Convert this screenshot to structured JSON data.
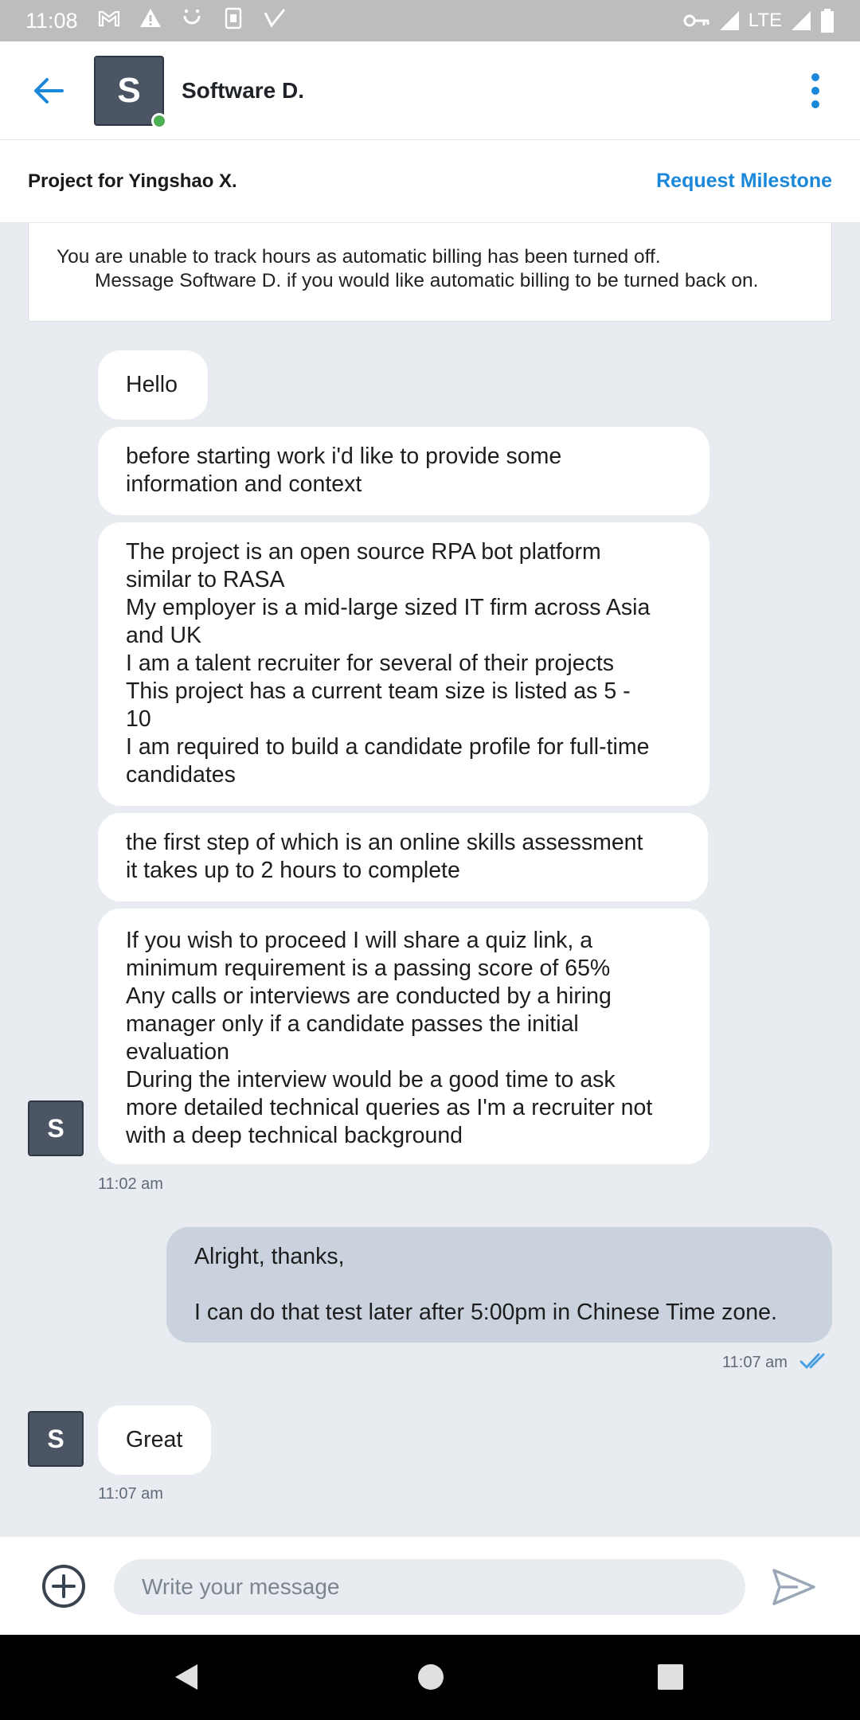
{
  "status_bar": {
    "time": "11:08",
    "network": "LTE",
    "icons_left": [
      "gmail-icon",
      "warning-icon",
      "face-icon",
      "sim-icon",
      "check-icon"
    ],
    "icons_right": [
      "vpn-key-icon",
      "signal-icon",
      "signal-icon",
      "battery-icon"
    ]
  },
  "header": {
    "avatar_letter": "S",
    "contact_name": "Software D.",
    "online": true
  },
  "project_bar": {
    "title": "Project for Yingshao X.",
    "action": "Request Milestone"
  },
  "notice": {
    "line1": "You are unable to track hours as automatic billing has been turned off.",
    "line2": "Message Software D. if you would like automatic billing to be turned back on."
  },
  "messages": {
    "m1": {
      "lines": [
        "Hello"
      ]
    },
    "m2": {
      "lines": [
        "before starting work i'd like to provide some",
        "information and context"
      ]
    },
    "m3": {
      "lines": [
        "The project is an open source RPA bot platform",
        "similar to RASA",
        "My employer is a mid-large sized IT firm across Asia",
        "and UK",
        "I am a talent recruiter for several of their projects",
        "This project has a current team size is listed as 5 -",
        "10",
        "I am required to build a candidate profile for full-time",
        "candidates"
      ]
    },
    "m4": {
      "lines": [
        "the first step of which is an online skills assessment",
        "it takes up to 2 hours to complete"
      ]
    },
    "m5": {
      "lines": [
        "If you wish to proceed I will share a quiz link, a",
        "minimum requirement is a passing score of 65%",
        "Any calls or interviews are conducted by a hiring",
        "manager only if a candidate passes the initial",
        "evaluation",
        "During the interview would be a good time to ask",
        "more detailed technical queries as I'm a recruiter not",
        "with a deep technical background"
      ]
    },
    "group1_time": "11:02 am",
    "m6": {
      "lines": [
        "Alright, thanks,",
        "",
        "I can do that test later after 5:00pm in Chinese Time zone."
      ]
    },
    "m6_time": "11:07 am",
    "m6_status": "read",
    "m7": {
      "lines": [
        "Great"
      ]
    },
    "m7_time": "11:07 am",
    "sender_avatar_letter": "S"
  },
  "composer": {
    "placeholder": "Write your message"
  },
  "colors": {
    "accent": "#1b87d8",
    "avatar": "#4b5563",
    "chat_background": "#e8ecf1",
    "outgoing_bubble": "#c9d2dd",
    "online": "#4caf50"
  }
}
